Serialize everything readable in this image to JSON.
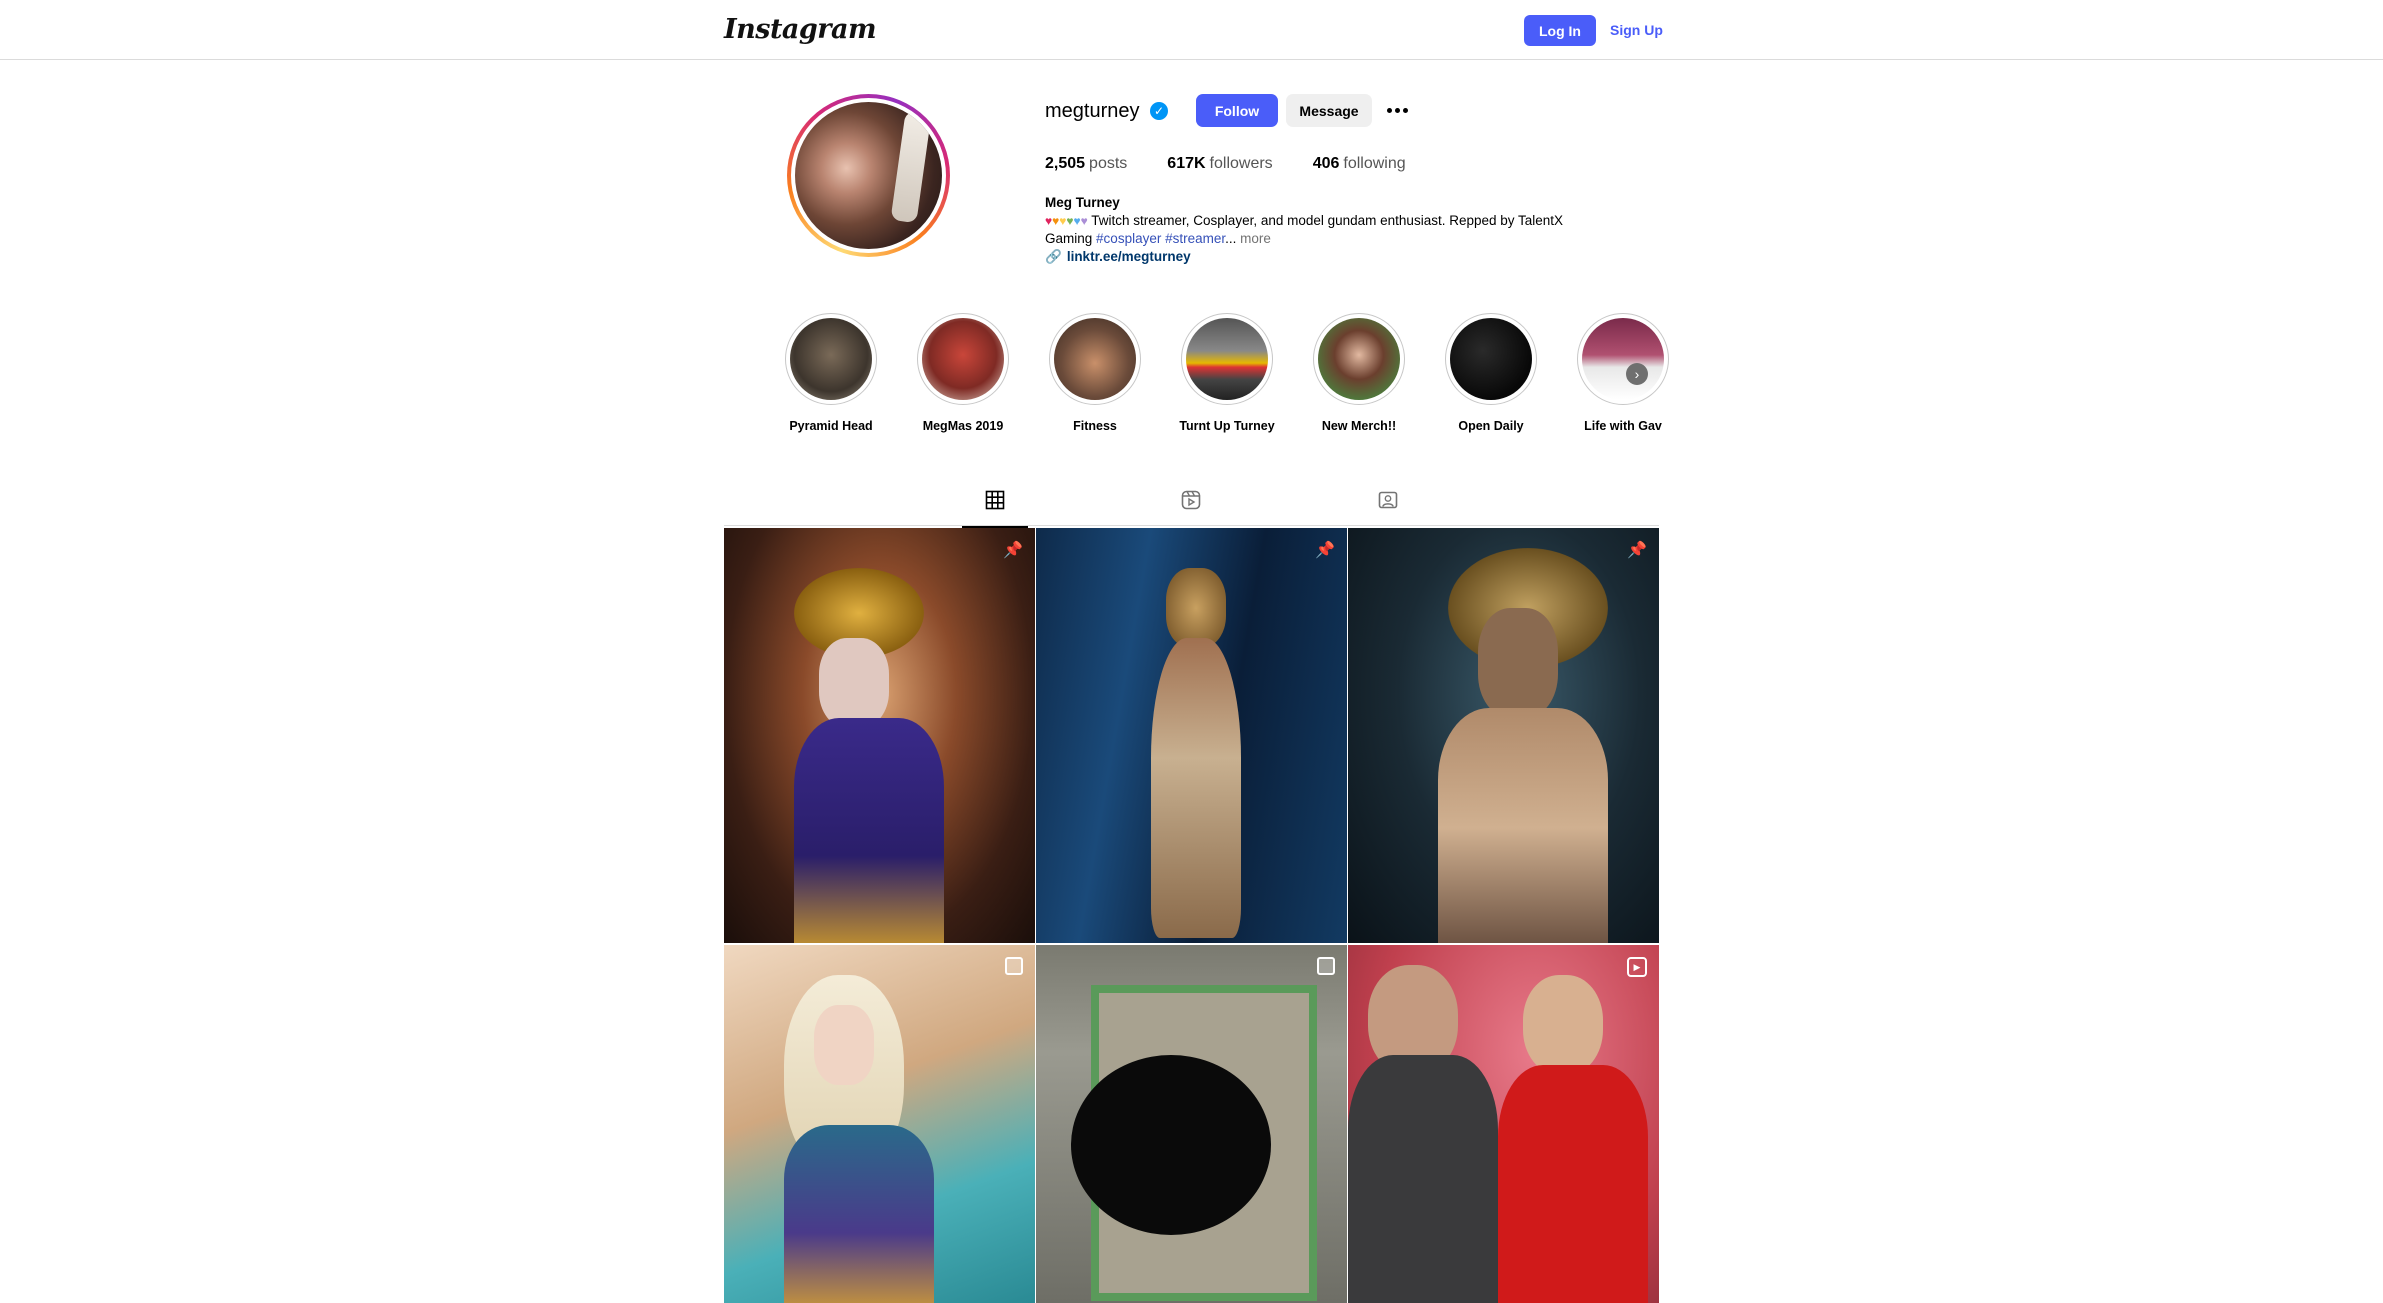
{
  "header": {
    "logo_text": "Instagram",
    "login_label": "Log In",
    "signup_label": "Sign Up"
  },
  "profile": {
    "username": "megturney",
    "verified": true,
    "follow_label": "Follow",
    "message_label": "Message",
    "stats": {
      "posts_count": "2,505",
      "posts_label": "posts",
      "followers_count": "617K",
      "followers_label": "followers",
      "following_count": "406",
      "following_label": "following"
    },
    "bio": {
      "name": "Meg Turney",
      "line1_text": "Twitch streamer, Cosplayer, and model gundam enthusiast. Repped by TalentX",
      "line2_prefix": "Gaming",
      "tag1": "#cosplayer",
      "tag2": "#streamer",
      "ellipsis": "...",
      "more": "more",
      "link": "linktr.ee/megturney",
      "heart_colors": [
        "#e0245e",
        "#f4900c",
        "#ffcc4d",
        "#77b255",
        "#55acee",
        "#aa8ed6"
      ]
    }
  },
  "highlights": [
    {
      "label": "Pyramid Head"
    },
    {
      "label": "MegMas 2019"
    },
    {
      "label": "Fitness"
    },
    {
      "label": "Turnt Up Turney"
    },
    {
      "label": "New Merch!!"
    },
    {
      "label": "Open Daily"
    },
    {
      "label": "Life with Gav"
    }
  ],
  "tabs": [
    {
      "name": "posts-tab",
      "icon": "grid-icon",
      "active": true
    },
    {
      "name": "reels-tab",
      "icon": "reels-icon",
      "active": false
    },
    {
      "name": "tagged-tab",
      "icon": "tagged-icon",
      "active": false
    }
  ],
  "posts": [
    {
      "badge": "pin-icon"
    },
    {
      "badge": "pin-icon"
    },
    {
      "badge": "pin-icon"
    },
    {
      "badge": "carousel-icon"
    },
    {
      "badge": "carousel-icon"
    },
    {
      "badge": "reel-icon"
    }
  ],
  "colors": {
    "accent": "#4a5df9",
    "verified": "#0095f6",
    "tag": "#3550b8",
    "link": "#00376b"
  }
}
